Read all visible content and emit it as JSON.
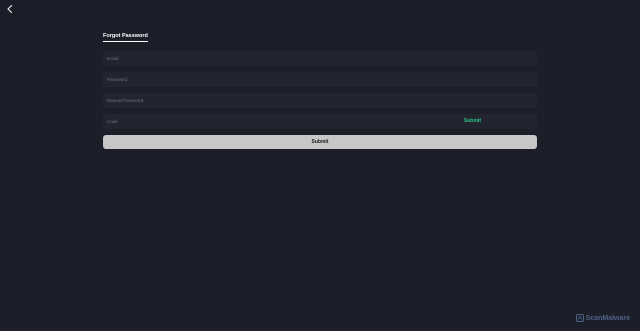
{
  "back_icon": "chevron-left-icon",
  "form": {
    "title": "Forgot Password",
    "email_placeholder": "Email",
    "password_placeholder": "Password",
    "repeat_password_placeholder": "Repeat Password",
    "code_placeholder": "Code",
    "send_code_label": "Submit",
    "submit_label": "Submit"
  },
  "watermark": {
    "text": "ScanMalware",
    "icon": "scanmalware-logo-icon"
  },
  "colors": {
    "background": "#1c1e29",
    "field_background": "#22242f",
    "accent_green": "#2bc58a",
    "button_background": "#c7c7c7"
  }
}
